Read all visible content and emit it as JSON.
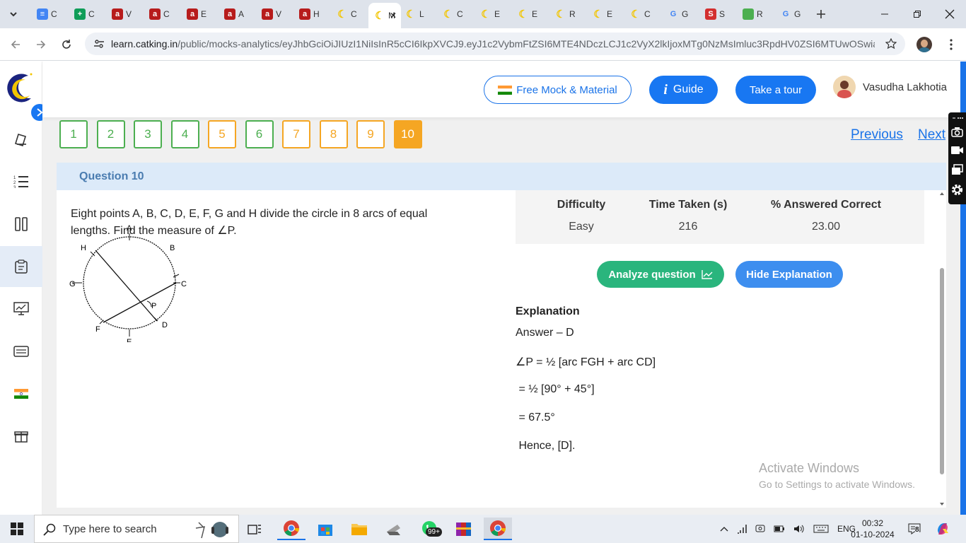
{
  "browser": {
    "tabs": [
      {
        "label": "C",
        "color": "#4285f4",
        "glyph": "≡"
      },
      {
        "label": "C",
        "color": "#0f9d58",
        "glyph": "+"
      },
      {
        "label": "V",
        "color": "#b71c1c",
        "glyph": "a"
      },
      {
        "label": "C",
        "color": "#b71c1c",
        "glyph": "a"
      },
      {
        "label": "E",
        "color": "#b71c1c",
        "glyph": "a"
      },
      {
        "label": "A",
        "color": "#b71c1c",
        "glyph": "a"
      },
      {
        "label": "V",
        "color": "#b71c1c",
        "glyph": "a"
      },
      {
        "label": "H",
        "color": "#b71c1c",
        "glyph": "a"
      },
      {
        "label": "C",
        "color": "#f2c500",
        "glyph": "☾"
      },
      {
        "label": "M",
        "color": "#f2c500",
        "glyph": "☾",
        "active": true
      },
      {
        "label": "L",
        "color": "#f2c500",
        "glyph": "☾"
      },
      {
        "label": "C",
        "color": "#f2c500",
        "glyph": "☾"
      },
      {
        "label": "E",
        "color": "#f2c500",
        "glyph": "☾"
      },
      {
        "label": "E",
        "color": "#f2c500",
        "glyph": "☾"
      },
      {
        "label": "R",
        "color": "#f2c500",
        "glyph": "☾"
      },
      {
        "label": "E",
        "color": "#f2c500",
        "glyph": "☾"
      },
      {
        "label": "C",
        "color": "#f2c500",
        "glyph": "☾"
      },
      {
        "label": "G",
        "color": "#4285f4",
        "glyph": "G"
      },
      {
        "label": "S",
        "color": "#d32f2f",
        "glyph": "S"
      },
      {
        "label": "R",
        "color": "#4caf50",
        "glyph": " "
      },
      {
        "label": "G",
        "color": "#4285f4",
        "glyph": "G"
      }
    ],
    "url_host": "learn.catking.in",
    "url_path": "/public/mocks-analytics/eyJhbGciOiJIUzI1NiIsInR5cCI6IkpXVCJ9.eyJ1c2VybmFtZSI6MTE4NDczLCJ1c2VyX2lkIjoxMTg0NzMsImluc3RpdHV0ZSI6MTUwOSwiaWQi..."
  },
  "header": {
    "free_mock_label": "Free Mock & Material",
    "guide_label": "Guide",
    "tour_label": "Take a tour",
    "user_name": "Vasudha Lakhotia"
  },
  "question_nav": {
    "items": [
      {
        "num": "1",
        "state": "green"
      },
      {
        "num": "2",
        "state": "green"
      },
      {
        "num": "3",
        "state": "green"
      },
      {
        "num": "4",
        "state": "green"
      },
      {
        "num": "5",
        "state": "orange"
      },
      {
        "num": "6",
        "state": "green"
      },
      {
        "num": "7",
        "state": "orange"
      },
      {
        "num": "8",
        "state": "orange"
      },
      {
        "num": "9",
        "state": "orange"
      },
      {
        "num": "10",
        "state": "current"
      }
    ],
    "previous_label": "Previous",
    "next_label": "Next"
  },
  "question": {
    "title": "Question 10",
    "text": "Eight points A, B, C, D, E, F, G and H divide the circle in 8 arcs of equal lengths. Find the measure of ∠P.",
    "figure_labels": {
      "A": "A",
      "B": "B",
      "C": "C",
      "D": "D",
      "E": "E",
      "F": "F",
      "G": "G",
      "H": "H",
      "P": "P"
    }
  },
  "stats": {
    "difficulty_label": "Difficulty",
    "difficulty_value": "Easy",
    "time_label": "Time Taken (s)",
    "time_value": "216",
    "correct_label": "% Answered Correct",
    "correct_value": "23.00"
  },
  "actions": {
    "analyze_label": "Analyze question",
    "hide_label": "Hide Explanation"
  },
  "explanation": {
    "heading": "Explanation",
    "lines": [
      "Answer – D",
      "∠P = ½ [arc FGH + arc CD]",
      " = ½ [90° + 45°]",
      " = 67.5°",
      " Hence, [D]."
    ]
  },
  "watermark": {
    "line1": "Activate Windows",
    "line2": "Go to Settings to activate Windows."
  },
  "taskbar": {
    "search_placeholder": "Type here to search",
    "badge": "99+",
    "lang": "ENG",
    "time": "00:32",
    "date": "01-10-2024",
    "notif": "8"
  }
}
